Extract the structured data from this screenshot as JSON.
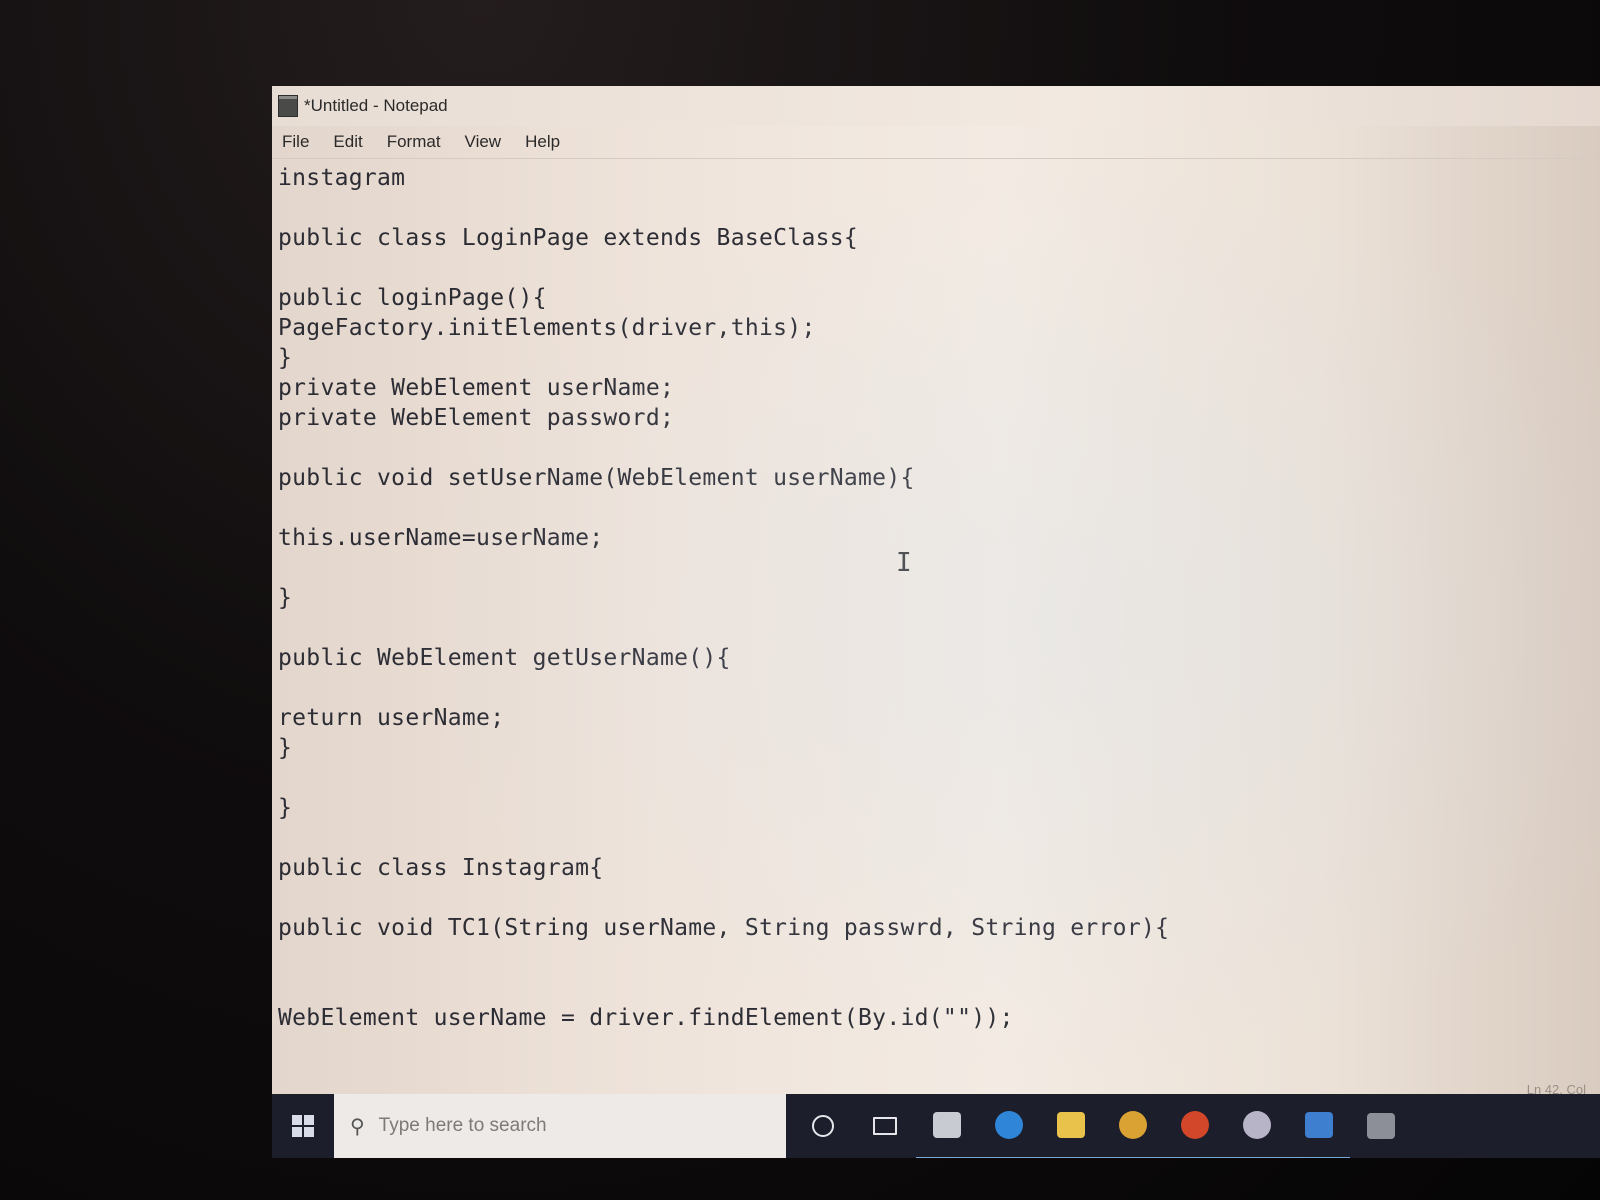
{
  "window": {
    "title": "*Untitled - Notepad"
  },
  "menu": [
    "File",
    "Edit",
    "Format",
    "View",
    "Help"
  ],
  "editor": {
    "lines": [
      "instagram",
      "",
      "public class LoginPage extends BaseClass{",
      "",
      "public loginPage(){",
      "PageFactory.initElements(driver,this);",
      "}",
      "private WebElement userName;",
      "private WebElement password;",
      "",
      "public void setUserName(WebElement userName){",
      "",
      "this.userName=userName;",
      "",
      "}",
      "",
      "public WebElement getUserName(){",
      "",
      "return userName;",
      "}",
      "",
      "}",
      "",
      "public class Instagram{",
      "",
      "public void TC1(String userName, String passwrd, String error){",
      "",
      "",
      "WebElement userName = driver.findElement(By.id(\"\"));"
    ]
  },
  "status_bar": {
    "position": "Ln 42, Col"
  },
  "taskbar": {
    "search_placeholder": "Type here to search",
    "icons": [
      {
        "name": "cortana-icon",
        "color": "#e6e6ea"
      },
      {
        "name": "task-view-icon",
        "color": "#e6e6ea"
      },
      {
        "name": "store-icon",
        "color": "#c9cbd3"
      },
      {
        "name": "edge-icon",
        "color": "#2f86d8"
      },
      {
        "name": "file-explorer-icon",
        "color": "#e8c24a"
      },
      {
        "name": "chrome-icon",
        "color": "#d9a233"
      },
      {
        "name": "powerpoint-icon",
        "color": "#d2462a"
      },
      {
        "name": "chrome-profile-icon",
        "color": "#b8b4c8"
      },
      {
        "name": "app-icon",
        "color": "#3f7fd0"
      },
      {
        "name": "pinned-app-icon",
        "color": "#8c8e98"
      }
    ]
  }
}
